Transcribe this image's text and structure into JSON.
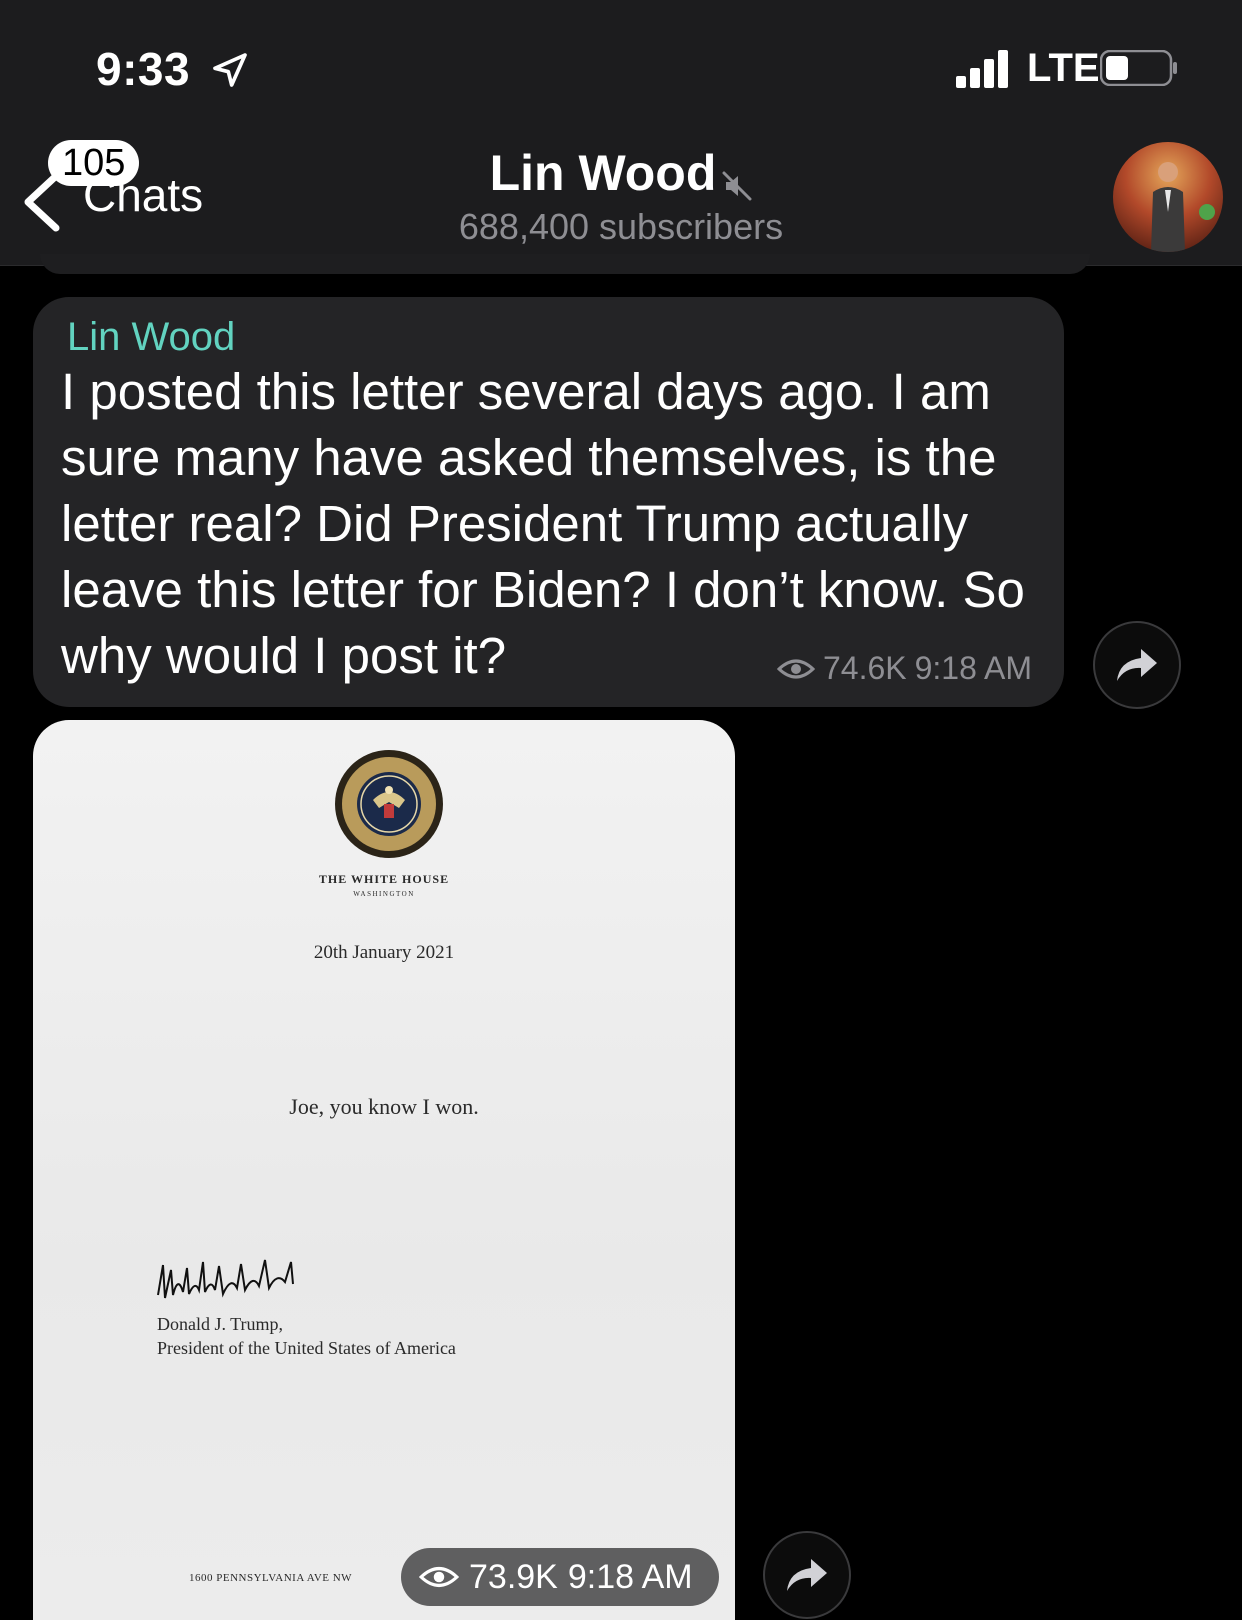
{
  "status_bar": {
    "time": "9:33",
    "network": "LTE"
  },
  "nav": {
    "back_label": "Chats",
    "unread_count": "105",
    "channel_name": "Lin Wood",
    "subscribers": "688,400 subscribers"
  },
  "messages": [
    {
      "sender": "Lin Wood",
      "text": "I posted this letter several days ago. I am sure many have asked themselves, is the letter real? Did President Trump actually leave this letter for Biden? I don’t know. So why would I post it?",
      "views": "74.6K",
      "time": "9:18 AM"
    },
    {
      "type": "photo",
      "views": "73.9K",
      "time": "9:18 AM",
      "letter": {
        "header": "THE WHITE HOUSE",
        "subheader": "WASHINGTON",
        "date": "20th January 2021",
        "body": "Joe, you know I won.",
        "signer": "Donald J. Trump,",
        "signer_title": "President of the United States of America",
        "address": "1600 PENNSYLVANIA AVE NW"
      }
    }
  ],
  "icons": {
    "location": "location-arrow-icon",
    "signal": "signal-bars-icon",
    "battery": "battery-icon",
    "back": "chevron-left-icon",
    "mute": "muted-speaker-icon",
    "views": "eye-icon",
    "share": "share-arrow-icon"
  },
  "colors": {
    "sender_name": "#62d3c0",
    "background": "#000000",
    "bubble": "#242426"
  }
}
